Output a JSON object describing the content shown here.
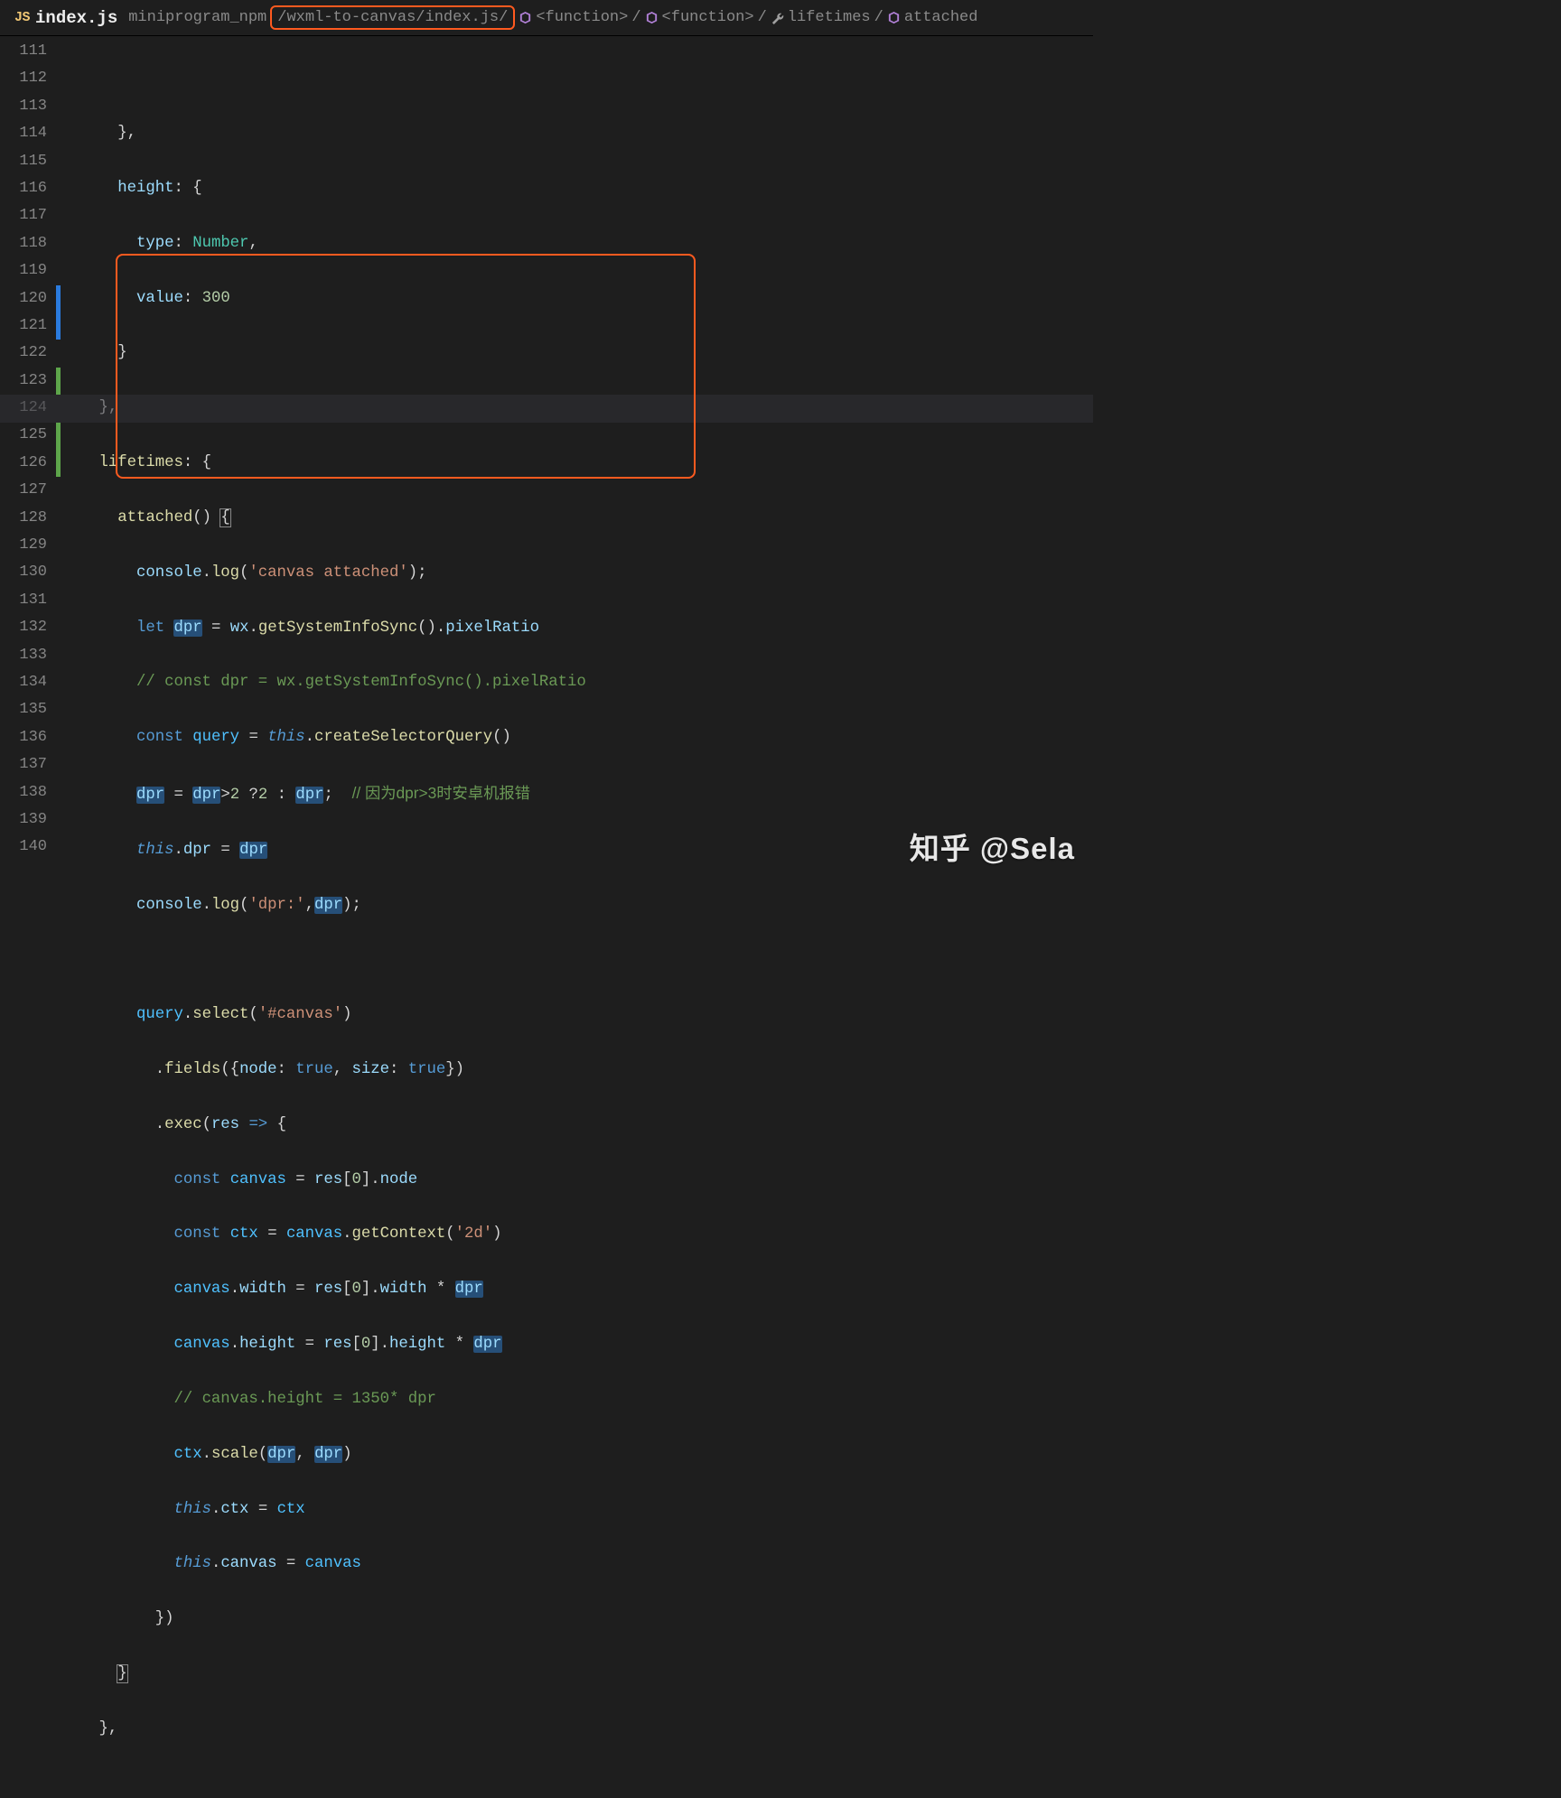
{
  "tab": {
    "lang_badge": "JS",
    "title": "index.js"
  },
  "breadcrumb": {
    "seg1": "miniprogram_npm",
    "seg2": "/wxml-to-canvas/index.js/",
    "fn1": "<function>",
    "fn2": "<function>",
    "lifetimes": "lifetimes",
    "attached": "attached",
    "sep": "/"
  },
  "lines": {
    "start": 111,
    "end": 140,
    "highlighted_line": 124
  },
  "gutter_marks": {
    "blue": [
      120,
      121
    ],
    "green": [
      123,
      125,
      126
    ]
  },
  "highlights": {
    "breadcrumb_box_target": "seg2",
    "code_box": {
      "top_line": 119,
      "bottom_line": 126
    }
  },
  "code": {
    "l111_op_brace": "}",
    "l111_comma": ",",
    "l112_prop": "height",
    "l112_colon": ":",
    "l112_brace": "{",
    "l113_prop": "type",
    "l113_colon": ":",
    "l113_val": "Number",
    "l113_comma": ",",
    "l114_prop": "value",
    "l114_colon": ":",
    "l114_val": "300",
    "l115_brace": "}",
    "l116_brace": "}",
    "l116_comma": ",",
    "l117_prop": "lifetimes",
    "l117_colon": ":",
    "l117_brace": "{",
    "l118_fn": "attached",
    "l118_parens": "()",
    "l118_brace": "{",
    "l119_obj": "console",
    "l119_dot": ".",
    "l119_fn": "log",
    "l119_p1": "(",
    "l119_str": "'canvas attached'",
    "l119_p2": ")",
    "l119_sc": ";",
    "l120_let": "let",
    "l120_dpr": "dpr",
    "l120_eq": "=",
    "l120_wx": "wx",
    "l120_fn": "getSystemInfoSync",
    "l120_parens": "()",
    "l120_prop": "pixelRatio",
    "l121_comment": "// const dpr = wx.getSystemInfoSync().pixelRatio",
    "l122_const": "const",
    "l122_var": "query",
    "l122_eq": "=",
    "l122_this": "this",
    "l122_fn": "createSelectorQuery",
    "l122_parens": "()",
    "l123_dpr1": "dpr",
    "l123_eq": "=",
    "l123_dpr2": "dpr",
    "l123_gt": ">",
    "l123_n1": "2",
    "l123_q": "?",
    "l123_n2": "2",
    "l123_colon": ":",
    "l123_dpr3": "dpr",
    "l123_sc": ";",
    "l123_comment": "// 因为dpr>3时安卓机报错",
    "l124_this": "this",
    "l124_dot": ".",
    "l124_prop": "dpr",
    "l124_eq": "=",
    "l124_dpr": "dpr",
    "l125_obj": "console",
    "l125_fn": "log",
    "l125_p1": "(",
    "l125_str": "'dpr:'",
    "l125_comma": ",",
    "l125_dpr": "dpr",
    "l125_p2": ")",
    "l125_sc": ";",
    "l127_var": "query",
    "l127_fn": "select",
    "l127_p1": "(",
    "l127_str": "'#canvas'",
    "l127_p2": ")",
    "l128_fn": "fields",
    "l128_p1": "({",
    "l128_k1": "node",
    "l128_c1": ":",
    "l128_v1": "true",
    "l128_cm": ",",
    "l128_k2": "size",
    "l128_c2": ":",
    "l128_v2": "true",
    "l128_p2": "})",
    "l129_fn": "exec",
    "l129_p1": "(",
    "l129_arg": "res",
    "l129_arrow": "=>",
    "l129_brace": "{",
    "l130_const": "const",
    "l130_var": "canvas",
    "l130_eq": "=",
    "l130_res": "res",
    "l130_idx": "[",
    "l130_n": "0",
    "l130_idx2": "]",
    "l130_prop": "node",
    "l131_const": "const",
    "l131_var": "ctx",
    "l131_eq": "=",
    "l131_canvas": "canvas",
    "l131_fn": "getContext",
    "l131_p1": "(",
    "l131_str": "'2d'",
    "l131_p2": ")",
    "l132_obj": "canvas",
    "l132_prop": "width",
    "l132_eq": "=",
    "l132_res": "res",
    "l132_idx": "[",
    "l132_n": "0",
    "l132_idx2": "]",
    "l132_prop2": "width",
    "l132_mul": "*",
    "l132_dpr": "dpr",
    "l133_obj": "canvas",
    "l133_prop": "height",
    "l133_eq": "=",
    "l133_res": "res",
    "l133_idx": "[",
    "l133_n": "0",
    "l133_idx2": "]",
    "l133_prop2": "height",
    "l133_mul": "*",
    "l133_dpr": "dpr",
    "l134_comment": "// canvas.height = 1350* dpr",
    "l135_obj": "ctx",
    "l135_fn": "scale",
    "l135_p1": "(",
    "l135_a1": "dpr",
    "l135_cm": ",",
    "l135_a2": "dpr",
    "l135_p2": ")",
    "l136_this": "this",
    "l136_prop": "ctx",
    "l136_eq": "=",
    "l136_val": "ctx",
    "l137_this": "this",
    "l137_prop": "canvas",
    "l137_eq": "=",
    "l137_val": "canvas",
    "l138_brace": "})",
    "l139_brace": "}",
    "l140_brace": "}",
    "l140_comma": ","
  },
  "watermark": "知乎 @Sela"
}
